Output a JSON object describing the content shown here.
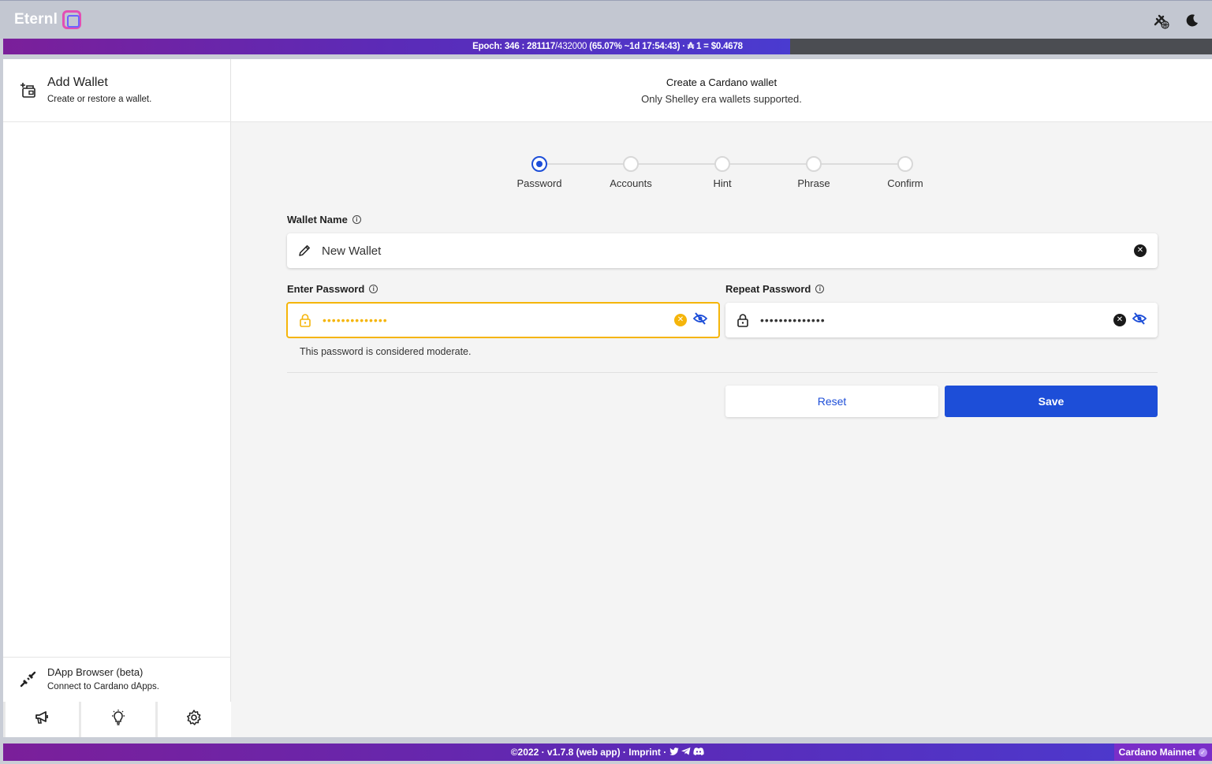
{
  "app": {
    "name": "Eternl"
  },
  "topbar": {
    "network_icon": "disconnected-network-icon",
    "theme_icon": "moon-icon"
  },
  "epoch": {
    "label": "Epoch:",
    "number": "346",
    "slot": "281117",
    "slot_total": "/432000",
    "progress_text": "(65.07% ~1d 17:54:43)",
    "price_prefix": "₳ 1 =",
    "price": "$0.4678",
    "progress": 0.6507
  },
  "sidebar": {
    "add_wallet": {
      "title": "Add Wallet",
      "subtitle": "Create or restore a wallet."
    },
    "dapp": {
      "title": "DApp Browser (beta)",
      "subtitle": "Connect to Cardano dApps."
    },
    "buttons": [
      "megaphone-icon",
      "lightbulb-icon",
      "gear-icon"
    ]
  },
  "main": {
    "title": "Create a Cardano wallet",
    "subtitle": "Only Shelley era wallets supported."
  },
  "stepper": {
    "steps": [
      "Password",
      "Accounts",
      "Hint",
      "Phrase",
      "Confirm"
    ],
    "active_index": 0
  },
  "form": {
    "wallet_name_label": "Wallet Name",
    "wallet_name_value": "New Wallet",
    "enter_password_label": "Enter Password",
    "enter_password_value": "••••••••••••••",
    "repeat_password_label": "Repeat Password",
    "repeat_password_value": "••••••••••••••",
    "password_hint": "This password is considered moderate."
  },
  "actions": {
    "reset": "Reset",
    "save": "Save"
  },
  "footer": {
    "text": "©2022 · v1.7.8 (web app) · Imprint ·",
    "network": "Cardano Mainnet"
  },
  "colors": {
    "accent": "#1d4ed8",
    "warning": "#f5b50a",
    "purple": "#7b1f9a"
  }
}
